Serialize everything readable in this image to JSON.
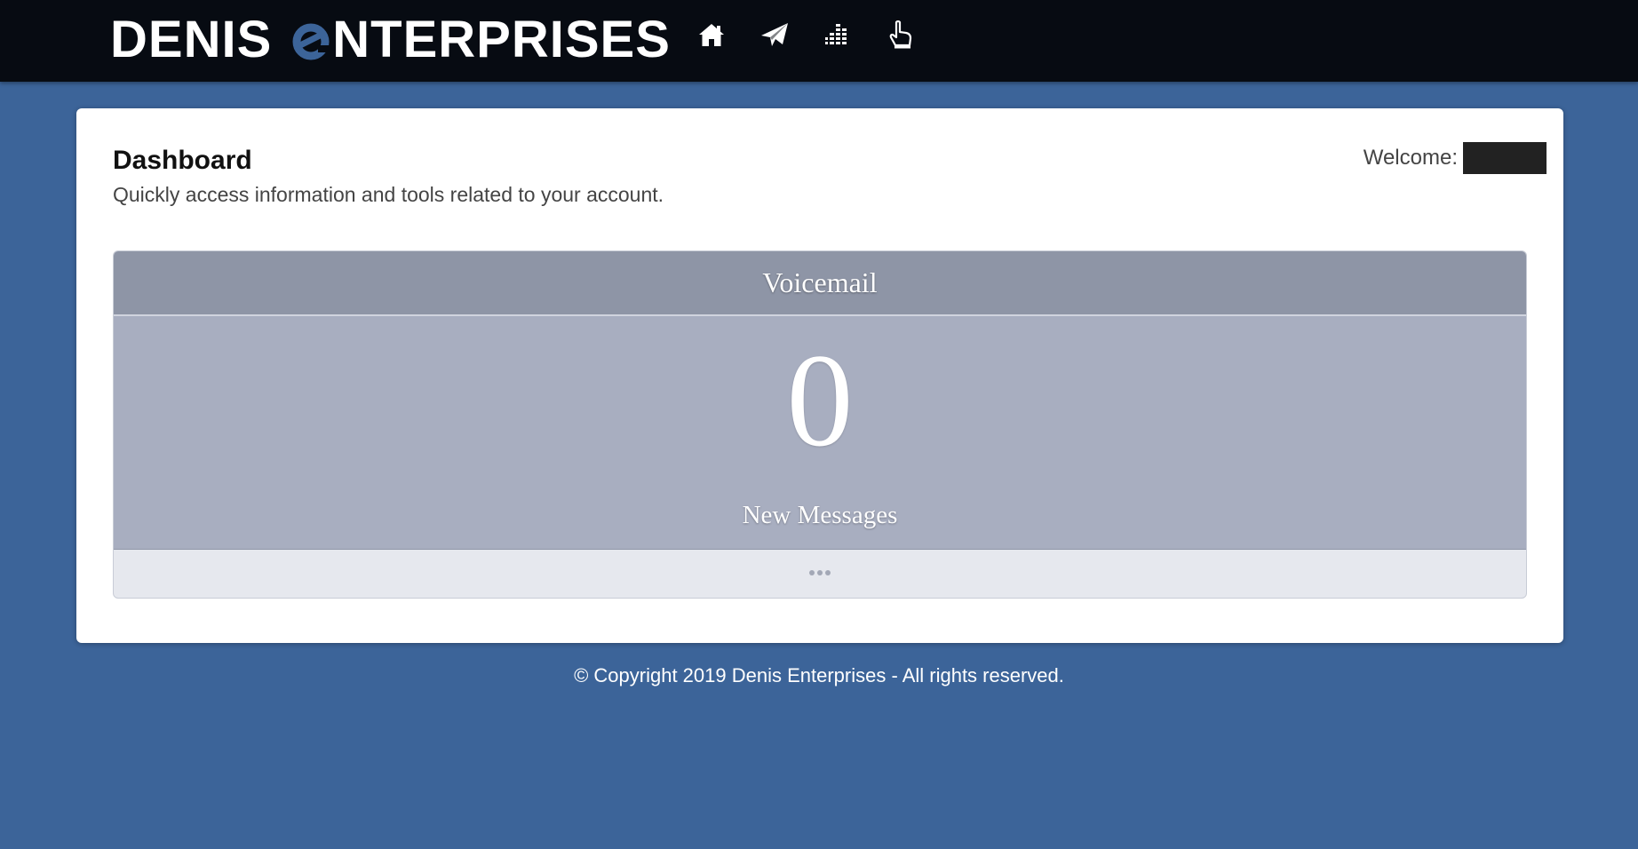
{
  "header": {
    "logo_first": "DENIS",
    "logo_rest": "NTERPRISES",
    "logo_accent_color": "#3c6499",
    "nav_icons": [
      "home-icon",
      "paper-plane-icon",
      "equalizer-icon",
      "pointing-hand-icon"
    ]
  },
  "dashboard": {
    "title": "Dashboard",
    "subtitle": "Quickly access information and tools related to your account.",
    "welcome_label": "Welcome:"
  },
  "voicemail_widget": {
    "title": "Voicemail",
    "count": "0",
    "label": "New Messages",
    "more_icon": "ellipsis-icon"
  },
  "footer": {
    "copyright": "© Copyright 2019 Denis Enterprises - All rights reserved."
  },
  "colors": {
    "background": "#3c6499",
    "topbar": "#070b12",
    "widget_header": "#8e95a6",
    "widget_body": "#a8aec0",
    "widget_footer": "#e6e8ee"
  }
}
